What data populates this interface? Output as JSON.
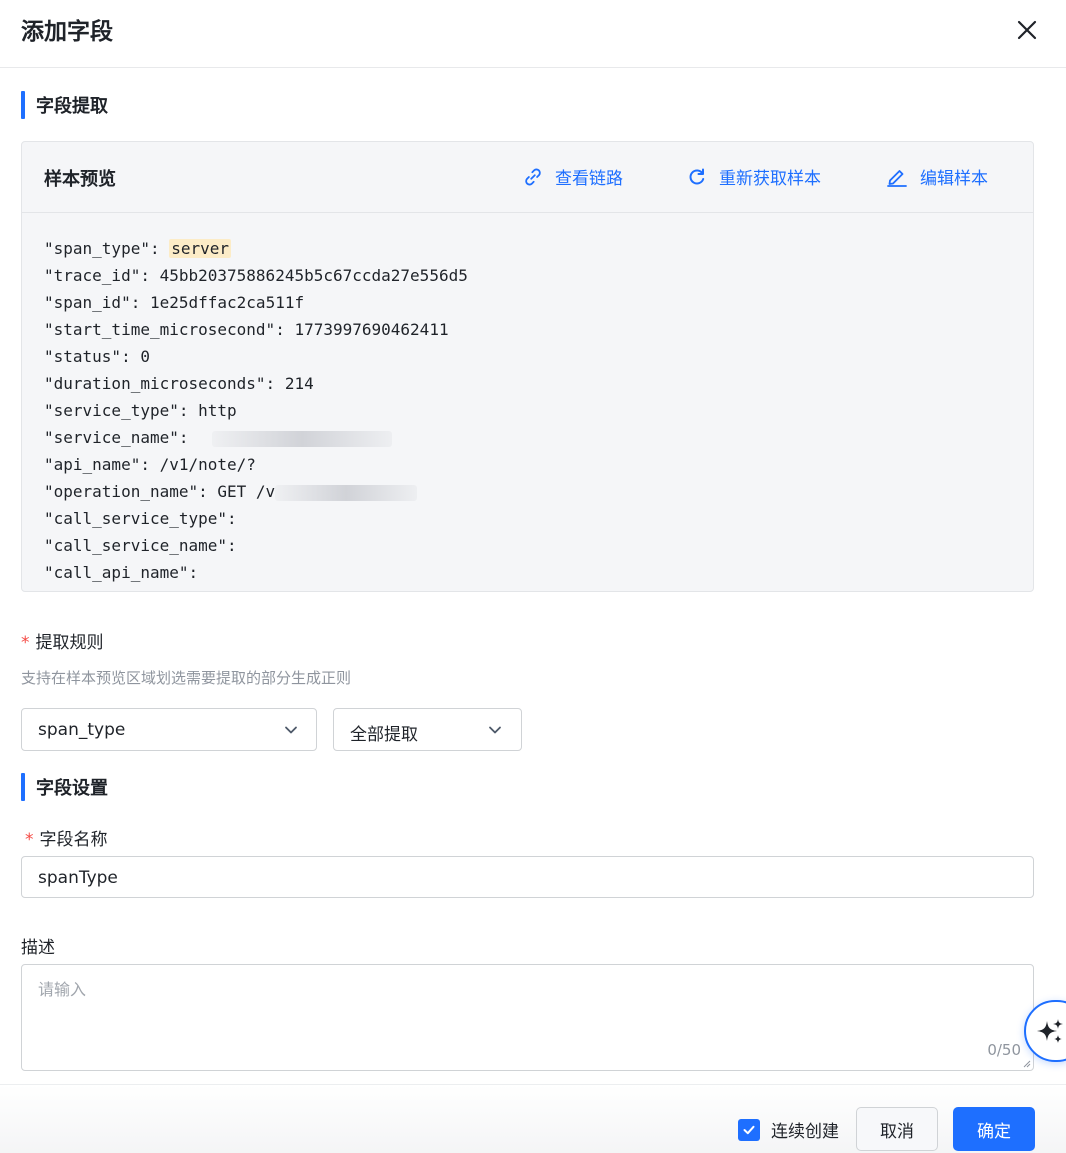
{
  "header": {
    "title": "添加字段"
  },
  "extract_section": {
    "title": "字段提取"
  },
  "sample": {
    "title": "样本预览",
    "actions": [
      {
        "label": "查看链路",
        "icon": "link-icon"
      },
      {
        "label": "重新获取样本",
        "icon": "refresh-icon"
      },
      {
        "label": "编辑样本",
        "icon": "edit-icon"
      }
    ],
    "lines": [
      {
        "key": "\"span_type\": ",
        "value": "server",
        "highlight": true
      },
      {
        "key": "\"trace_id\": ",
        "value": "45bb20375886245b5c67ccda27e556d5"
      },
      {
        "key": "\"span_id\": ",
        "value": "1e25dffac2ca511f"
      },
      {
        "key": "\"start_time_microsecond\": ",
        "value": "1773997690462411"
      },
      {
        "key": "\"status\": ",
        "value": "0"
      },
      {
        "key": "\"duration_microseconds\": ",
        "value": "214"
      },
      {
        "key": "\"service_type\": ",
        "value": "http"
      },
      {
        "key": "\"service_name\": ",
        "value": "",
        "redacted": true
      },
      {
        "key": "\"api_name\": ",
        "value": "/v1/note/?"
      },
      {
        "key": "\"operation_name\": ",
        "value": "GET /v",
        "redacted": true
      },
      {
        "key": "\"call_service_type\": ",
        "value": ""
      },
      {
        "key": "\"call_service_name\": ",
        "value": ""
      },
      {
        "key": "\"call_api_name\": ",
        "value": ""
      }
    ]
  },
  "rule": {
    "required_mark": "*",
    "label": "提取规则",
    "hint": "支持在样本预览区域划选需要提取的部分生成正则",
    "field_select": "span_type",
    "mode_select": "全部提取"
  },
  "settings_section": {
    "title": "字段设置"
  },
  "name_field": {
    "required_mark": "*",
    "label": "字段名称",
    "value": "spanType"
  },
  "desc_field": {
    "label": "描述",
    "placeholder": "请输入",
    "count": "0/50"
  },
  "footer": {
    "continuous_label": "连续创建",
    "continuous_checked": true,
    "cancel": "取消",
    "ok": "确定"
  },
  "colors": {
    "primary": "#1e6fff",
    "required": "#f54a45",
    "highlight": "#fcecc7"
  }
}
